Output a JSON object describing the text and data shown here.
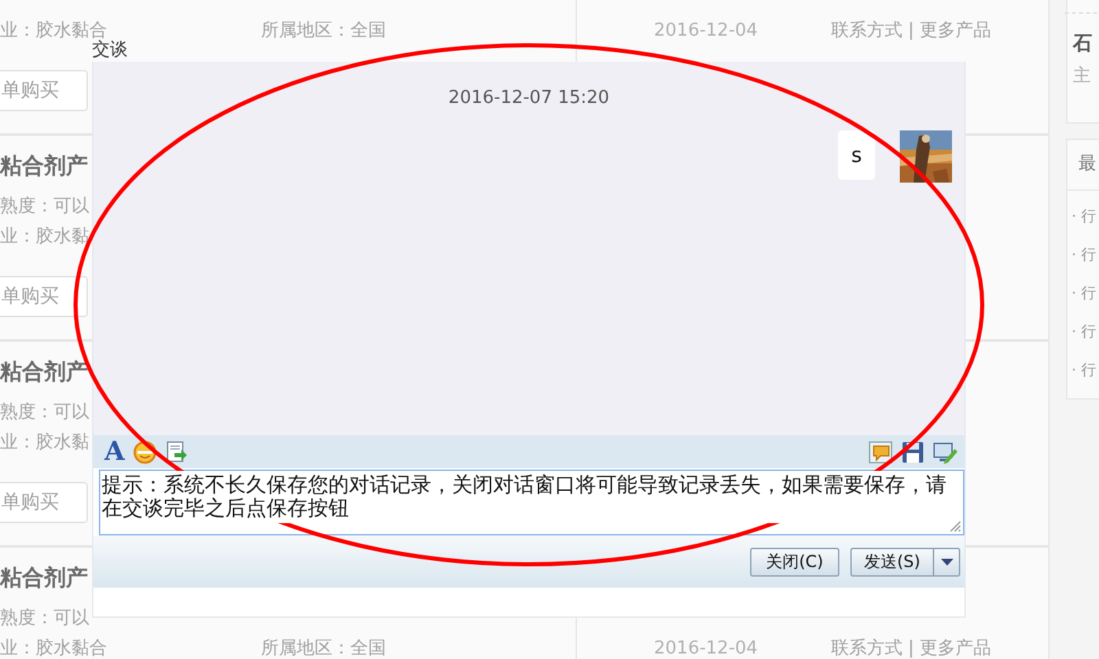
{
  "listing": {
    "cards": [
      {
        "industry": "业：胶水黏合",
        "region": "所属地区：全国",
        "date": "2016-12-04",
        "contact": "联系方式",
        "separator": "|",
        "more": "更多产品",
        "buy": "单购买"
      },
      {
        "title": "粘合剂产",
        "maturity": "熟度：可以",
        "industry": "业：胶水黏",
        "buy": "单购买"
      },
      {
        "title": "粘合剂产",
        "maturity": "熟度：可以",
        "industry": "业：胶水黏",
        "buy": "单购买"
      },
      {
        "title": "粘合剂产",
        "maturity": "熟度：可以",
        "industry": "业：胶水黏合",
        "region": "所属地区：全国",
        "date": "2016-12-04",
        "contact": "联系方式",
        "separator": "|",
        "more": "更多产品"
      }
    ]
  },
  "sidebar": {
    "company": "石",
    "business": "主",
    "box_title": "最",
    "items": [
      "· 行",
      "· 行",
      "· 行",
      "· 行",
      "· 行"
    ]
  },
  "dialog": {
    "title": "交谈",
    "messages": [
      {
        "kind": "timestamp",
        "text": "2016-12-07 15:20"
      },
      {
        "kind": "outgoing",
        "text": "s"
      }
    ],
    "toolbar": {
      "font_glyph": "A"
    },
    "input": {
      "value": "提示：系统不长久保存您的对话记录，关闭对话窗口将可能导致记录丢失，如果需要保存，请在交谈完毕之后点保存按钮"
    },
    "buttons": {
      "close": "关闭(C)",
      "send": "发送(S)"
    }
  },
  "annotations": [
    {
      "kind": "ellipse"
    }
  ]
}
